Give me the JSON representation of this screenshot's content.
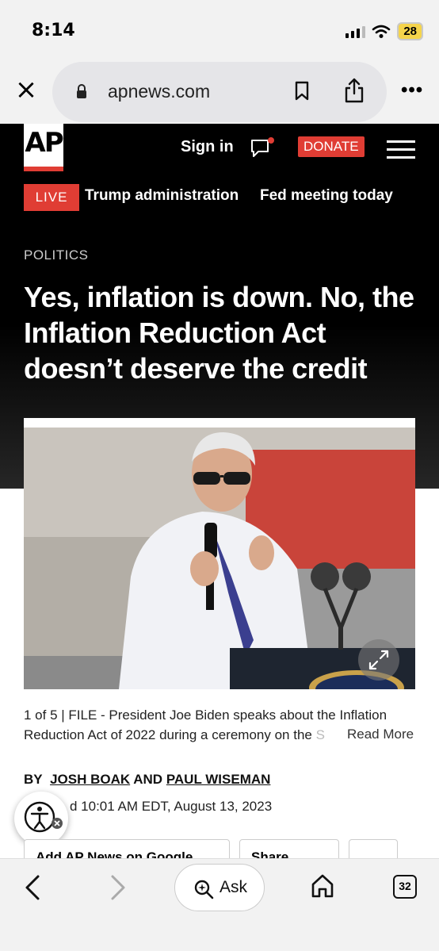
{
  "status_bar": {
    "time": "8:14",
    "battery": "28"
  },
  "browser": {
    "url": "apnews.com",
    "tab_count": "32",
    "ask_label": "Ask"
  },
  "site": {
    "logo": "AP",
    "sign_in": "Sign in",
    "donate": "DONATE",
    "live": "LIVE",
    "nav": [
      "Trump administration",
      "Fed meeting today"
    ]
  },
  "article": {
    "kicker": "POLITICS",
    "headline": "Yes, inflation is down. No, the Inflation Reduction Act doesn’t deserve the credit",
    "caption_main": "1 of 5 |  FILE - President Joe Biden speaks about the Inflation Reduction Act of 2022 during a ceremony on the",
    "caption_fade": " S",
    "read_more": "Read More",
    "byline_prefix": "BY",
    "author1": "JOSH BOAK",
    "byline_and": "AND",
    "author2": "PAUL WISEMAN",
    "updated": "d 10:01 AM EDT, August 13, 2023",
    "add_google": "Add AP News on Google",
    "share": "Share"
  },
  "colors": {
    "ap_red": "#e03d34",
    "header_bg": "#000000",
    "battery": "#f5d44b"
  }
}
